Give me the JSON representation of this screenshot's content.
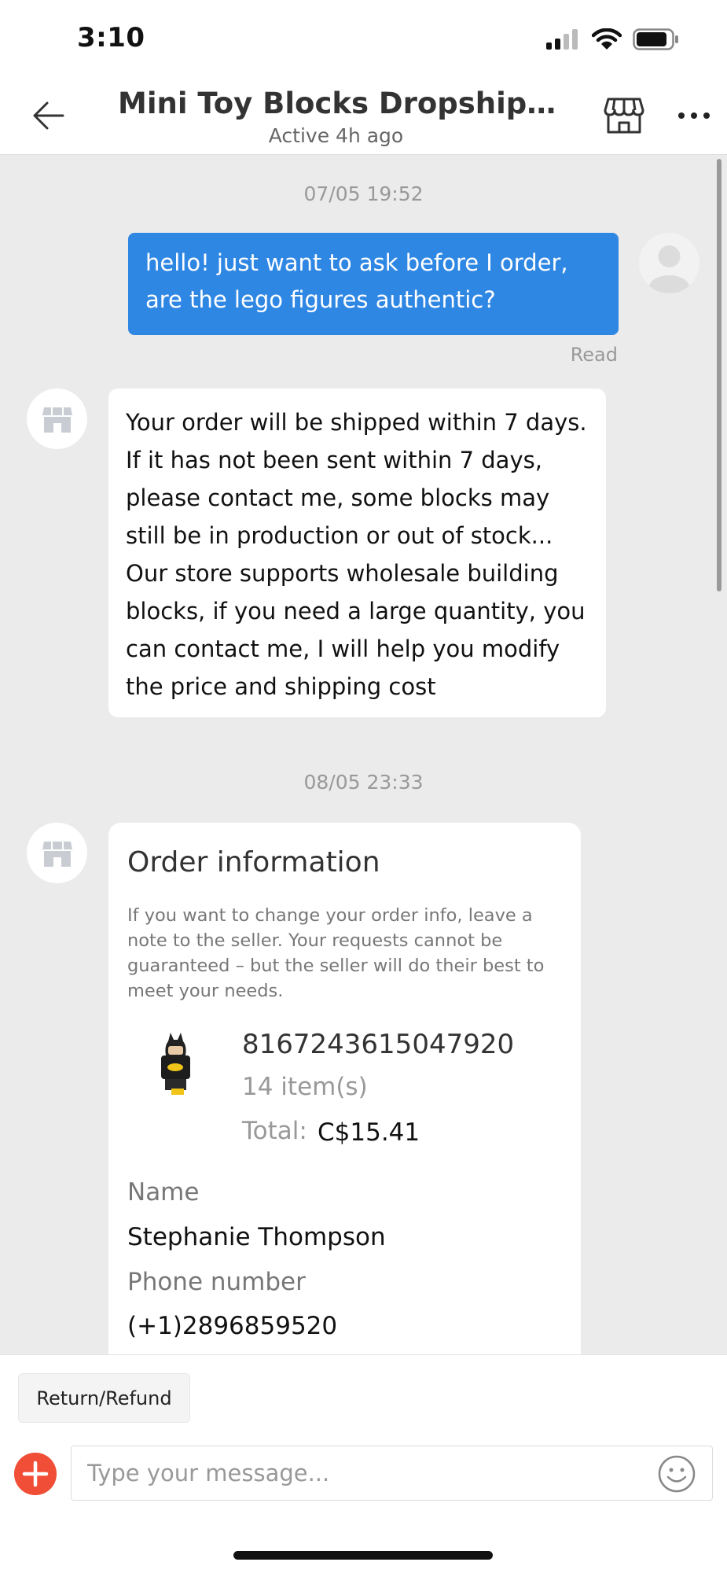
{
  "status_bar": {
    "time": "3:10"
  },
  "header": {
    "title": "Mini Toy Blocks Dropshippin...",
    "subtitle": "Active 4h ago",
    "icons": {
      "back": "back-arrow-icon",
      "store": "store-icon",
      "more": "more-icon"
    }
  },
  "chat": {
    "date1": "07/05 19:52",
    "outgoing_message": "hello! just want to ask before I order, are the lego figures authentic?",
    "read_status": "Read",
    "incoming_message": "Your order will be shipped within 7 days. If it has not been sent within 7 days, please contact me, some blocks may still be in production or out of stock... Our store supports wholesale building blocks, if you need a large quantity, you can contact me, I will help you modify the price and shipping cost",
    "date2": "08/05 23:33",
    "order_card": {
      "title": "Order information",
      "note": "If you want to change your order info, leave a note to the seller. Your requests cannot be guaranteed – but the seller will do their best to meet your needs.",
      "order_id": "8167243615047920",
      "items": "14 item(s)",
      "total_label": "Total:",
      "total_value": "C$15.41",
      "name_label": "Name",
      "name_value": "Stephanie Thompson",
      "phone_label": "Phone number",
      "phone_value": "(+1)2896859520"
    }
  },
  "bottom": {
    "refund_button": "Return/Refund",
    "message_placeholder": "Type your message..."
  },
  "colors": {
    "outgoing_bubble": "#2f87e4",
    "add_button": "#f04e37",
    "chat_bg": "#ebebeb"
  }
}
